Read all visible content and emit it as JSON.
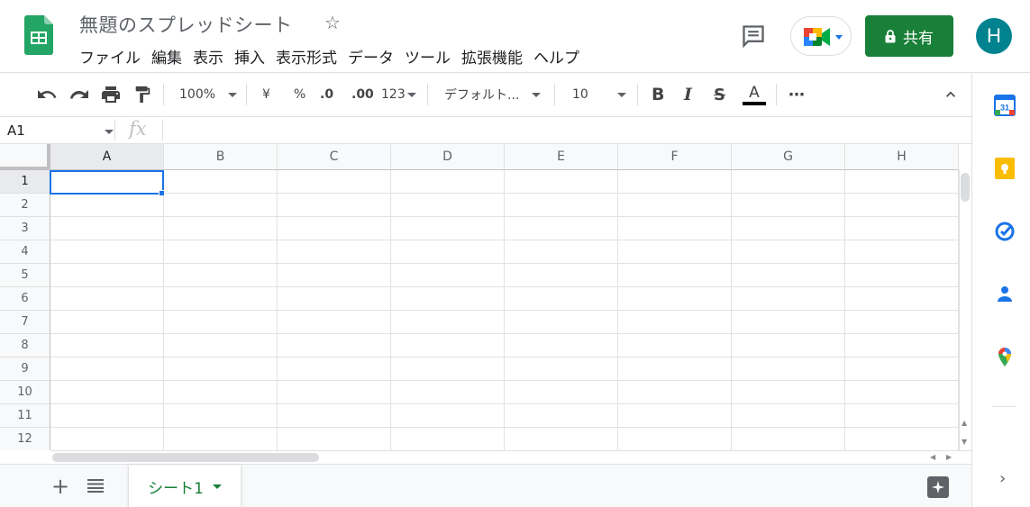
{
  "header": {
    "doc_title": "無題のスプレッドシート",
    "star_label": "☆",
    "menu": [
      "ファイル",
      "編集",
      "表示",
      "挿入",
      "表示形式",
      "データ",
      "ツール",
      "拡張機能",
      "ヘルプ"
    ],
    "share_label": "共有",
    "avatar_initial": "H",
    "brand_color": "#188038"
  },
  "toolbar": {
    "zoom": "100%",
    "currency": "¥",
    "percent": "%",
    "decimal_less": ".0",
    "decimal_more": ".00",
    "number_format": "123",
    "font": "デフォルト...",
    "font_size": "10",
    "bold": "B",
    "italic": "I",
    "strike": "S",
    "text_color": "A",
    "more": "⋯"
  },
  "formula_bar": {
    "cell_ref": "A1",
    "fx_label": "fx",
    "value": ""
  },
  "grid": {
    "columns": [
      "A",
      "B",
      "C",
      "D",
      "E",
      "F",
      "G",
      "H"
    ],
    "rows": [
      "1",
      "2",
      "3",
      "4",
      "5",
      "6",
      "7",
      "8",
      "9",
      "10",
      "11",
      "12"
    ],
    "active_cell": "A1"
  },
  "sheets": {
    "tabs": [
      "シート1"
    ],
    "active": "シート1"
  },
  "side_panel": {
    "calendar_day": "31"
  }
}
